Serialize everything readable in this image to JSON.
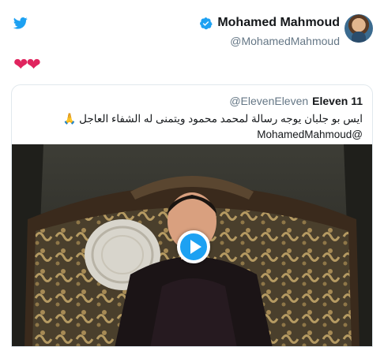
{
  "author": {
    "name": "Mohamed Mahmoud",
    "handle": "@MohamedMahmoud",
    "verified": true
  },
  "tweet": {
    "text": "❤❤"
  },
  "quoted": {
    "name": "Eleven 11",
    "handle": "@ElevenEleven",
    "text_line1": "ايس بو جلبان يوجه رسالة لمحمد محمود ويتمنى له الشفاء العاجل 🙏",
    "text_line2": "@MohamedMahmoud",
    "media": {
      "type": "video",
      "icon": "play-icon"
    }
  },
  "icons": {
    "brand": "twitter-bird-icon",
    "verified": "verified-badge-icon"
  },
  "colors": {
    "twitter_blue": "#1da1f2",
    "heart_red": "#e0245e",
    "handle_gray": "#657786"
  }
}
